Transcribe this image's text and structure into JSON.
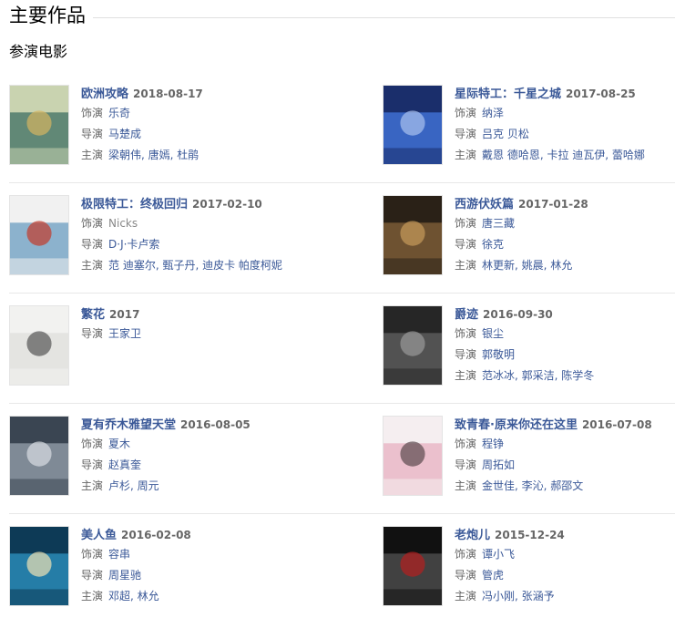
{
  "section": {
    "title": "主要作品",
    "subtitle": "参演电影"
  },
  "labels": {
    "role": "饰演",
    "director": "导演",
    "cast": "主演"
  },
  "films": [
    {
      "title": "欧洲攻略",
      "date": "2018-08-17",
      "role": "乐奇",
      "director": "马楚成",
      "cast": "梁朝伟, 唐嫣, 杜鹃",
      "poster_colors": [
        "#c9d3b0",
        "#4f7a6c",
        "#d4b561"
      ]
    },
    {
      "title": "星际特工：千星之城",
      "date": "2017-08-25",
      "role": "纳泽",
      "director": "吕克 贝松",
      "cast": "戴恩 德哈恩, 卡拉 迪瓦伊, 蕾哈娜",
      "poster_colors": [
        "#1a2e6b",
        "#3f6fd1",
        "#a9c2ee"
      ]
    },
    {
      "title": "极限特工：终极回归",
      "date": "2017-02-10",
      "role": "Nicks",
      "director": "D·J·卡卢索",
      "cast": "范 迪塞尔, 甄子丹, 迪皮卡 帕度柯妮",
      "poster_colors": [
        "#f1f1f1",
        "#7aa7c7",
        "#c23a2b"
      ]
    },
    {
      "title": "西游伏妖篇",
      "date": "2017-01-28",
      "role": "唐三藏",
      "director": "徐克",
      "cast": "林更新, 姚晨, 林允",
      "poster_colors": [
        "#2a2117",
        "#7a5a36",
        "#c69b5b"
      ]
    },
    {
      "title": "繁花",
      "date": "2017",
      "director": "王家卫",
      "poster_colors": [
        "#f2f2f0",
        "#e2e2de",
        "#555555"
      ]
    },
    {
      "title": "爵迹",
      "date": "2016-09-30",
      "role": "银尘",
      "director": "郭敬明",
      "cast": "范冰冰, 郭采洁, 陈学冬",
      "poster_colors": [
        "#262626",
        "#5a5a5a",
        "#9a9a9a"
      ]
    },
    {
      "title": "夏有乔木雅望天堂",
      "date": "2016-08-05",
      "role": "夏木",
      "director": "赵真奎",
      "cast": "卢杉, 周元",
      "poster_colors": [
        "#3a4552",
        "#8c96a2",
        "#d9dde2"
      ]
    },
    {
      "title": "致青春·原来你还在这里",
      "date": "2016-07-08",
      "role": "程铮",
      "director": "周拓如",
      "cast": "金世佳, 李沁, 郝邵文",
      "poster_colors": [
        "#f5eef0",
        "#e9b7c7",
        "#5b4a4f"
      ]
    },
    {
      "title": "美人鱼",
      "date": "2016-02-08",
      "role": "容串",
      "director": "周星驰",
      "cast": "邓超, 林允",
      "poster_colors": [
        "#0d3a56",
        "#2a89b5",
        "#f0e2b4"
      ]
    },
    {
      "title": "老炮儿",
      "date": "2015-12-24",
      "role": "谭小飞",
      "director": "管虎",
      "cast": "冯小刚, 张涵予",
      "poster_colors": [
        "#111111",
        "#4a4a4a",
        "#b52020"
      ]
    }
  ]
}
